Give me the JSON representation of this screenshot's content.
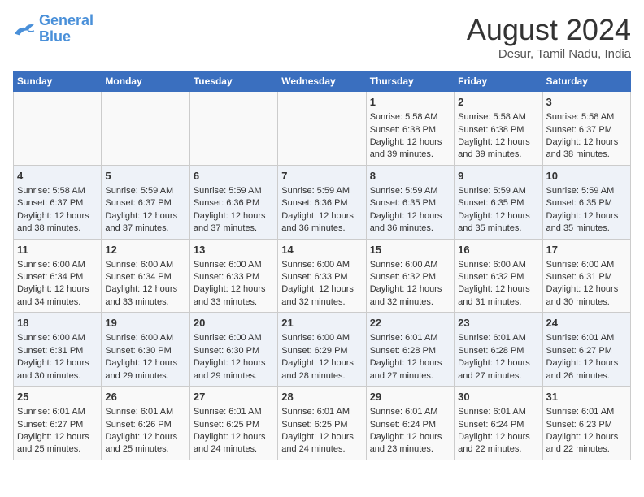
{
  "header": {
    "logo_line1": "General",
    "logo_line2": "Blue",
    "month": "August 2024",
    "location": "Desur, Tamil Nadu, India"
  },
  "days_of_week": [
    "Sunday",
    "Monday",
    "Tuesday",
    "Wednesday",
    "Thursday",
    "Friday",
    "Saturday"
  ],
  "weeks": [
    [
      {
        "day": "",
        "info": ""
      },
      {
        "day": "",
        "info": ""
      },
      {
        "day": "",
        "info": ""
      },
      {
        "day": "",
        "info": ""
      },
      {
        "day": "1",
        "info": "Sunrise: 5:58 AM\nSunset: 6:38 PM\nDaylight: 12 hours\nand 39 minutes."
      },
      {
        "day": "2",
        "info": "Sunrise: 5:58 AM\nSunset: 6:38 PM\nDaylight: 12 hours\nand 39 minutes."
      },
      {
        "day": "3",
        "info": "Sunrise: 5:58 AM\nSunset: 6:37 PM\nDaylight: 12 hours\nand 38 minutes."
      }
    ],
    [
      {
        "day": "4",
        "info": "Sunrise: 5:58 AM\nSunset: 6:37 PM\nDaylight: 12 hours\nand 38 minutes."
      },
      {
        "day": "5",
        "info": "Sunrise: 5:59 AM\nSunset: 6:37 PM\nDaylight: 12 hours\nand 37 minutes."
      },
      {
        "day": "6",
        "info": "Sunrise: 5:59 AM\nSunset: 6:36 PM\nDaylight: 12 hours\nand 37 minutes."
      },
      {
        "day": "7",
        "info": "Sunrise: 5:59 AM\nSunset: 6:36 PM\nDaylight: 12 hours\nand 36 minutes."
      },
      {
        "day": "8",
        "info": "Sunrise: 5:59 AM\nSunset: 6:35 PM\nDaylight: 12 hours\nand 36 minutes."
      },
      {
        "day": "9",
        "info": "Sunrise: 5:59 AM\nSunset: 6:35 PM\nDaylight: 12 hours\nand 35 minutes."
      },
      {
        "day": "10",
        "info": "Sunrise: 5:59 AM\nSunset: 6:35 PM\nDaylight: 12 hours\nand 35 minutes."
      }
    ],
    [
      {
        "day": "11",
        "info": "Sunrise: 6:00 AM\nSunset: 6:34 PM\nDaylight: 12 hours\nand 34 minutes."
      },
      {
        "day": "12",
        "info": "Sunrise: 6:00 AM\nSunset: 6:34 PM\nDaylight: 12 hours\nand 33 minutes."
      },
      {
        "day": "13",
        "info": "Sunrise: 6:00 AM\nSunset: 6:33 PM\nDaylight: 12 hours\nand 33 minutes."
      },
      {
        "day": "14",
        "info": "Sunrise: 6:00 AM\nSunset: 6:33 PM\nDaylight: 12 hours\nand 32 minutes."
      },
      {
        "day": "15",
        "info": "Sunrise: 6:00 AM\nSunset: 6:32 PM\nDaylight: 12 hours\nand 32 minutes."
      },
      {
        "day": "16",
        "info": "Sunrise: 6:00 AM\nSunset: 6:32 PM\nDaylight: 12 hours\nand 31 minutes."
      },
      {
        "day": "17",
        "info": "Sunrise: 6:00 AM\nSunset: 6:31 PM\nDaylight: 12 hours\nand 30 minutes."
      }
    ],
    [
      {
        "day": "18",
        "info": "Sunrise: 6:00 AM\nSunset: 6:31 PM\nDaylight: 12 hours\nand 30 minutes."
      },
      {
        "day": "19",
        "info": "Sunrise: 6:00 AM\nSunset: 6:30 PM\nDaylight: 12 hours\nand 29 minutes."
      },
      {
        "day": "20",
        "info": "Sunrise: 6:00 AM\nSunset: 6:30 PM\nDaylight: 12 hours\nand 29 minutes."
      },
      {
        "day": "21",
        "info": "Sunrise: 6:00 AM\nSunset: 6:29 PM\nDaylight: 12 hours\nand 28 minutes."
      },
      {
        "day": "22",
        "info": "Sunrise: 6:01 AM\nSunset: 6:28 PM\nDaylight: 12 hours\nand 27 minutes."
      },
      {
        "day": "23",
        "info": "Sunrise: 6:01 AM\nSunset: 6:28 PM\nDaylight: 12 hours\nand 27 minutes."
      },
      {
        "day": "24",
        "info": "Sunrise: 6:01 AM\nSunset: 6:27 PM\nDaylight: 12 hours\nand 26 minutes."
      }
    ],
    [
      {
        "day": "25",
        "info": "Sunrise: 6:01 AM\nSunset: 6:27 PM\nDaylight: 12 hours\nand 25 minutes."
      },
      {
        "day": "26",
        "info": "Sunrise: 6:01 AM\nSunset: 6:26 PM\nDaylight: 12 hours\nand 25 minutes."
      },
      {
        "day": "27",
        "info": "Sunrise: 6:01 AM\nSunset: 6:25 PM\nDaylight: 12 hours\nand 24 minutes."
      },
      {
        "day": "28",
        "info": "Sunrise: 6:01 AM\nSunset: 6:25 PM\nDaylight: 12 hours\nand 24 minutes."
      },
      {
        "day": "29",
        "info": "Sunrise: 6:01 AM\nSunset: 6:24 PM\nDaylight: 12 hours\nand 23 minutes."
      },
      {
        "day": "30",
        "info": "Sunrise: 6:01 AM\nSunset: 6:24 PM\nDaylight: 12 hours\nand 22 minutes."
      },
      {
        "day": "31",
        "info": "Sunrise: 6:01 AM\nSunset: 6:23 PM\nDaylight: 12 hours\nand 22 minutes."
      }
    ]
  ]
}
